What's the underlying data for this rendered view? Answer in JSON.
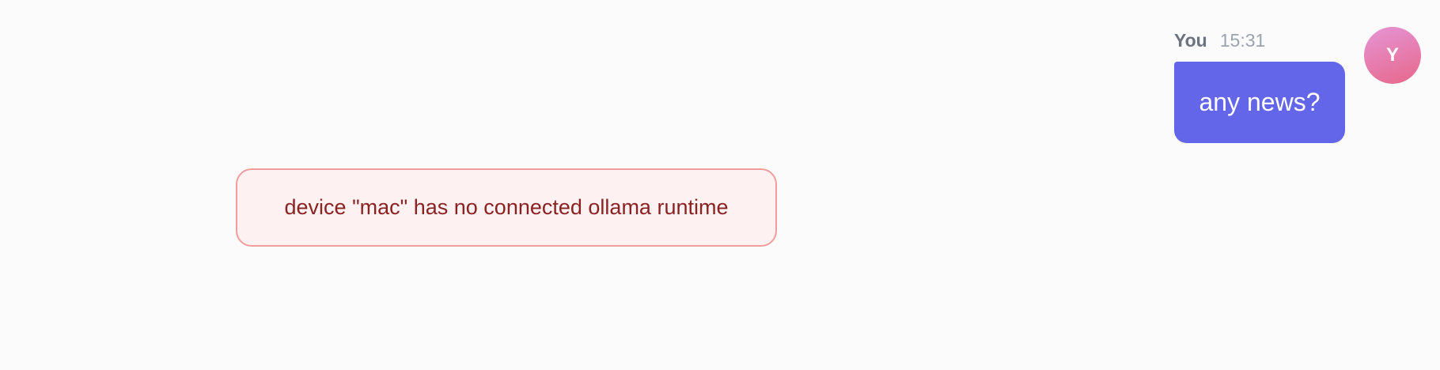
{
  "user_message": {
    "avatar_initial": "Y",
    "sender": "You",
    "time": "15:31",
    "text": "any news?"
  },
  "error_message": {
    "text": "device \"mac\" has no connected ollama runtime"
  },
  "colors": {
    "background": "#fbfbfb",
    "user_bubble": "#6366e8",
    "avatar_gradient_start": "#e595d6",
    "avatar_gradient_end": "#e7678a",
    "error_background": "#fdf1f1",
    "error_border": "#ef9d9d",
    "error_text": "#8b2222"
  }
}
